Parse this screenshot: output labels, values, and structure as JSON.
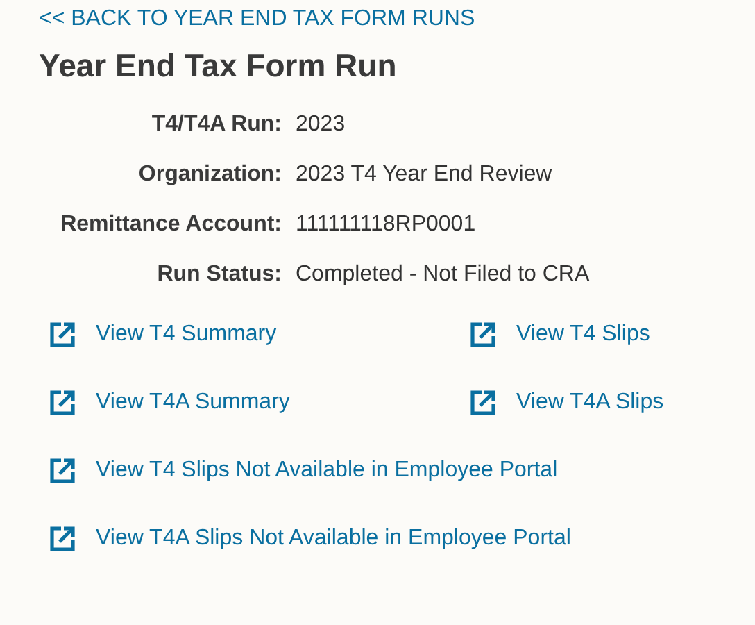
{
  "back_link": "<< BACK TO YEAR END TAX FORM RUNS",
  "title": "Year End Tax Form Run",
  "fields": [
    {
      "label": "T4/T4A Run:",
      "value": "2023"
    },
    {
      "label": "Organization:",
      "value": "2023 T4 Year End Review"
    },
    {
      "label": "Remittance Account:",
      "value": "111111118RP0001"
    },
    {
      "label": "Run Status:",
      "value": "Completed - Not Filed to CRA"
    }
  ],
  "link_rows": [
    [
      "View T4 Summary",
      "View T4 Slips"
    ],
    [
      "View T4A Summary",
      "View T4A Slips"
    ],
    [
      "View T4 Slips Not Available in Employee Portal"
    ],
    [
      "View T4A Slips Not Available in Employee Portal"
    ]
  ]
}
